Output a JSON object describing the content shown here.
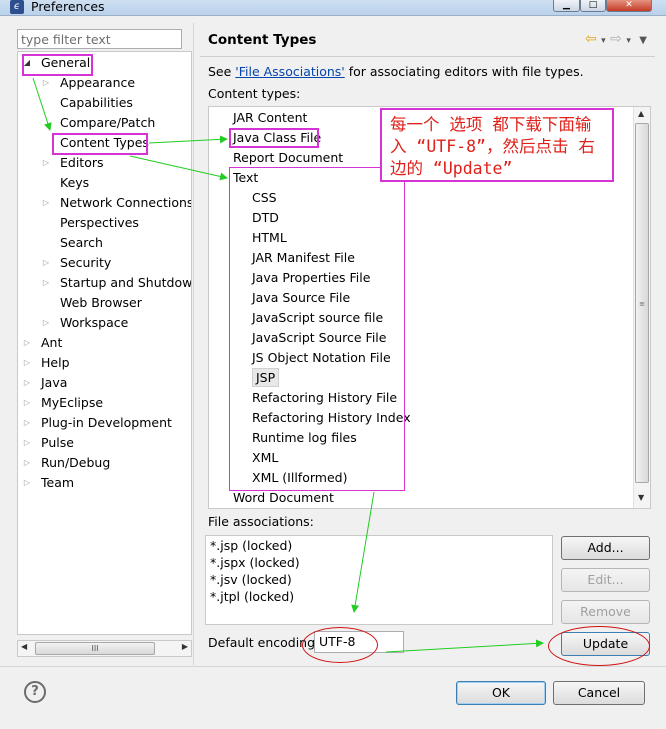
{
  "window": {
    "title": "Preferences",
    "app_icon": "eclipse-icon",
    "buttons": [
      "minimize-icon",
      "maximize-icon",
      "close-icon"
    ]
  },
  "filter": {
    "placeholder": "type filter text"
  },
  "tree": [
    {
      "label": "General",
      "level": 0,
      "expanded": true
    },
    {
      "label": "Appearance",
      "level": 1,
      "expandable": true
    },
    {
      "label": "Capabilities",
      "level": 1
    },
    {
      "label": "Compare/Patch",
      "level": 1
    },
    {
      "label": "Content Types",
      "level": 1,
      "selected": true
    },
    {
      "label": "Editors",
      "level": 1,
      "expandable": true
    },
    {
      "label": "Keys",
      "level": 1
    },
    {
      "label": "Network Connections",
      "level": 1,
      "expandable": true
    },
    {
      "label": "Perspectives",
      "level": 1
    },
    {
      "label": "Search",
      "level": 1
    },
    {
      "label": "Security",
      "level": 1,
      "expandable": true
    },
    {
      "label": "Startup and Shutdown",
      "level": 1,
      "expandable": true
    },
    {
      "label": "Web Browser",
      "level": 1
    },
    {
      "label": "Workspace",
      "level": 1,
      "expandable": true
    },
    {
      "label": "Ant",
      "level": 0,
      "expandable": true
    },
    {
      "label": "Help",
      "level": 0,
      "expandable": true
    },
    {
      "label": "Java",
      "level": 0,
      "expandable": true
    },
    {
      "label": "MyEclipse",
      "level": 0,
      "expandable": true
    },
    {
      "label": "Plug-in Development",
      "level": 0,
      "expandable": true
    },
    {
      "label": "Pulse",
      "level": 0,
      "expandable": true
    },
    {
      "label": "Run/Debug",
      "level": 0,
      "expandable": true
    },
    {
      "label": "Team",
      "level": 0,
      "expandable": true
    }
  ],
  "page": {
    "title": "Content Types",
    "assoc_prefix": "See ",
    "assoc_link": "'File Associations'",
    "assoc_suffix": " for associating editors with file types.",
    "content_types_label": "Content types:",
    "file_assoc_label": "File associations:",
    "encoding_label": "Default encoding:",
    "encoding_value": "UTF-8"
  },
  "content_types": [
    {
      "label": "JAR Content",
      "level": 0
    },
    {
      "label": "Java Class File",
      "level": 0
    },
    {
      "label": "Report Document",
      "level": 0
    },
    {
      "label": "Text",
      "level": 0
    },
    {
      "label": "CSS",
      "level": 1
    },
    {
      "label": "DTD",
      "level": 1
    },
    {
      "label": "HTML",
      "level": 1
    },
    {
      "label": "JAR Manifest File",
      "level": 1
    },
    {
      "label": "Java Properties File",
      "level": 1
    },
    {
      "label": "Java Source File",
      "level": 1
    },
    {
      "label": "JavaScript source file",
      "level": 1
    },
    {
      "label": "JavaScript Source File",
      "level": 1
    },
    {
      "label": "JS Object Notation File",
      "level": 1
    },
    {
      "label": "JSP",
      "level": 1,
      "selected": true
    },
    {
      "label": "Refactoring History File",
      "level": 1
    },
    {
      "label": "Refactoring History Index",
      "level": 1
    },
    {
      "label": "Runtime log files",
      "level": 1
    },
    {
      "label": "XML",
      "level": 1
    },
    {
      "label": "XML (Illformed)",
      "level": 1
    },
    {
      "label": "Word Document",
      "level": 0
    }
  ],
  "file_associations": [
    "*.jsp (locked)",
    "*.jspx (locked)",
    "*.jsv (locked)",
    "*.jtpl (locked)"
  ],
  "buttons": {
    "add": "Add...",
    "edit": "Edit...",
    "remove": "Remove",
    "update": "Update",
    "ok": "OK",
    "cancel": "Cancel"
  },
  "annotation": {
    "note": "每一个 选项 都下载下面输入 “UTF-8”，然后点击 右边的 “Update”"
  },
  "colors": {
    "highlight": "#d633d6",
    "note_text": "#e0201a",
    "arrow": "#22cc22"
  }
}
